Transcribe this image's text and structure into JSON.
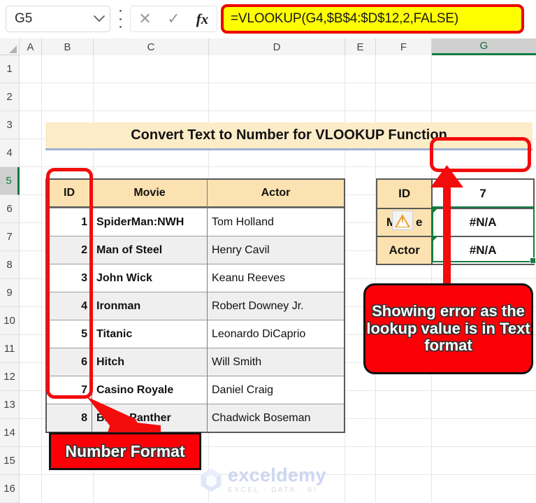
{
  "formula_bar": {
    "name_box_value": "G5",
    "formula": "=VLOOKUP(G4,$B$4:$D$12,2,FALSE)",
    "cancel_icon": "close-icon",
    "enter_icon": "check-icon",
    "function_icon": "fx-icon",
    "chevron_icon": "chevron-down-icon",
    "menu_icon": "more-options-icon"
  },
  "grid": {
    "column_headers": [
      "A",
      "B",
      "C",
      "D",
      "E",
      "F",
      "G"
    ],
    "selected_column": "G",
    "row_headers": [
      "1",
      "2",
      "3",
      "4",
      "5",
      "6",
      "7",
      "8",
      "9",
      "10",
      "11",
      "12",
      "13",
      "14",
      "15",
      "16"
    ],
    "selected_row": "5"
  },
  "title_banner": {
    "text": "Convert Text to Number for VLOOKUP Function",
    "background": "#fdecc8",
    "underline_color": "#9fb0d4"
  },
  "main_table": {
    "headers": [
      "ID",
      "Movie",
      "Actor"
    ],
    "header_background": "#fce2b0",
    "rows": [
      {
        "id": "1",
        "movie": "SpiderMan:NWH",
        "actor": "Tom Holland"
      },
      {
        "id": "2",
        "movie": "Man of Steel",
        "actor": "Henry Cavil"
      },
      {
        "id": "3",
        "movie": "John Wick",
        "actor": "Keanu Reeves"
      },
      {
        "id": "4",
        "movie": "Ironman",
        "actor": "Robert Downey Jr."
      },
      {
        "id": "5",
        "movie": "Titanic",
        "actor": "Leonardo DiCaprio"
      },
      {
        "id": "6",
        "movie": "Hitch",
        "actor": "Will Smith"
      },
      {
        "id": "7",
        "movie": "Casino Royale",
        "actor": "Daniel Craig"
      },
      {
        "id": "8",
        "movie": "Black Panther",
        "actor": "Chadwick Boseman"
      }
    ]
  },
  "lookup_table": {
    "rows": [
      {
        "label": "ID",
        "value": "7"
      },
      {
        "label": "Movie",
        "value": "#N/A"
      },
      {
        "label": "Actor",
        "value": "#N/A"
      }
    ],
    "warning_icon": "warning-triangle-icon",
    "movie_label_left": "M",
    "movie_label_right": "e"
  },
  "callouts": {
    "error_note": "Showing error as the lookup value is in Text format",
    "number_format_note": "Number Format",
    "color": "#fb0007"
  },
  "watermark": {
    "name": "exceldemy",
    "tagline": "EXCEL · DATA · BI"
  }
}
